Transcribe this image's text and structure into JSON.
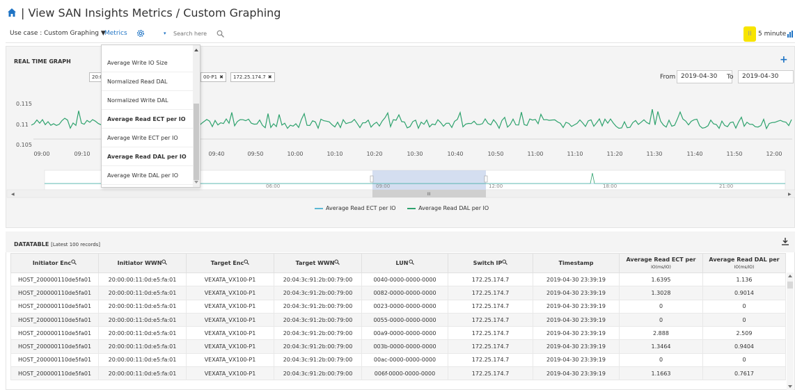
{
  "header": {
    "title": "| View SAN Insights Metrics / Custom Graphing"
  },
  "toolbar": {
    "use_case_label": "Use case : Custom Graphing ▼",
    "metrics_label": "Metrics",
    "metrics_caret": "▾",
    "search_placeholder": "Search here",
    "pause_label": "II",
    "interval_label": "5 minute",
    "accent_color": "#f7e400"
  },
  "realtime": {
    "title": "REAL TIME GRAPH",
    "tags": [
      {
        "label": "20:0"
      },
      {
        "label": "00-P1",
        "close": "✖"
      },
      {
        "label": "172.25.174.7",
        "close": "✖"
      }
    ],
    "from_label": "From",
    "from_value": "2019-04-30",
    "to_label": "To",
    "to_value": "2019-04-30"
  },
  "dropdown": {
    "items": [
      {
        "label": "Average Write IO Size",
        "bold": false
      },
      {
        "label": "Normalized Read DAL",
        "bold": false
      },
      {
        "label": "Normalized Write DAL",
        "bold": false
      },
      {
        "label": "Average Read ECT per IO",
        "bold": true
      },
      {
        "label": "Average Write ECT per IO",
        "bold": false
      },
      {
        "label": "Average Read DAL per IO",
        "bold": true
      },
      {
        "label": "Average Write DAL per IO",
        "bold": false
      }
    ]
  },
  "chart_data": {
    "type": "line",
    "x_ticks": [
      "09:00",
      "09:10",
      "09:40",
      "09:50",
      "10:00",
      "10:10",
      "10:20",
      "10:30",
      "10:40",
      "10:50",
      "11:00",
      "11:10",
      "11:20",
      "11:30",
      "11:40",
      "11:50",
      "12:00"
    ],
    "y_ticks": [
      "0.115",
      "0.11",
      "0.105"
    ],
    "ylim": [
      0.105,
      0.115
    ],
    "series": [
      {
        "name": "Average Read ECT per IO",
        "color": "#5bb8d4"
      },
      {
        "name": "Average Read DAL per IO",
        "color": "#2ea26d"
      }
    ],
    "navigator_ticks": [
      "06:00",
      "09:00",
      "12:00",
      "18:00",
      "21:00"
    ],
    "navigator_scroll_glyph": "III",
    "navigator_left_arrow": "◀",
    "navigator_right_arrow": "▶"
  },
  "datatable": {
    "title": "DATATABLE",
    "subtitle": "[Latest 100 records]",
    "columns": [
      {
        "label": "Initiator Enc",
        "sortable": true
      },
      {
        "label": "Initiator WWN",
        "sortable": true
      },
      {
        "label": "Target Enc",
        "sortable": true
      },
      {
        "label": "Target WWN",
        "sortable": true
      },
      {
        "label": "LUN",
        "sortable": true
      },
      {
        "label": "Switch IP",
        "sortable": true
      },
      {
        "label": "Timestamp",
        "sortable": false
      },
      {
        "label": "Average Read ECT per",
        "sub": "IO(ms/IO)"
      },
      {
        "label": "Average Read DAL per",
        "sub": "IO(ms/IO)"
      }
    ],
    "rows": [
      [
        "HOST_200000110de5fa01",
        "20:00:00:11:0d:e5:fa:01",
        "VEXATA_VX100-P1",
        "20:04:3c:91:2b:00:79:00",
        "0040-0000-0000-0000",
        "172.25.174.7",
        "2019-04-30 23:39:19",
        "1.6395",
        "1.136"
      ],
      [
        "HOST_200000110de5fa01",
        "20:00:00:11:0d:e5:fa:01",
        "VEXATA_VX100-P1",
        "20:04:3c:91:2b:00:79:00",
        "0082-0000-0000-0000",
        "172.25.174.7",
        "2019-04-30 23:39:19",
        "1.3028",
        "0.9014"
      ],
      [
        "HOST_200000110de5fa01",
        "20:00:00:11:0d:e5:fa:01",
        "VEXATA_VX100-P1",
        "20:04:3c:91:2b:00:79:00",
        "0023-0000-0000-0000",
        "172.25.174.7",
        "2019-04-30 23:39:19",
        "0",
        "0"
      ],
      [
        "HOST_200000110de5fa01",
        "20:00:00:11:0d:e5:fa:01",
        "VEXATA_VX100-P1",
        "20:04:3c:91:2b:00:79:00",
        "0055-0000-0000-0000",
        "172.25.174.7",
        "2019-04-30 23:39:19",
        "0",
        "0"
      ],
      [
        "HOST_200000110de5fa01",
        "20:00:00:11:0d:e5:fa:01",
        "VEXATA_VX100-P1",
        "20:04:3c:91:2b:00:79:00",
        "00a9-0000-0000-0000",
        "172.25.174.7",
        "2019-04-30 23:39:19",
        "2.888",
        "2.509"
      ],
      [
        "HOST_200000110de5fa01",
        "20:00:00:11:0d:e5:fa:01",
        "VEXATA_VX100-P1",
        "20:04:3c:91:2b:00:79:00",
        "003b-0000-0000-0000",
        "172.25.174.7",
        "2019-04-30 23:39:19",
        "1.3464",
        "0.9404"
      ],
      [
        "HOST_200000110de5fa01",
        "20:00:00:11:0d:e5:fa:01",
        "VEXATA_VX100-P1",
        "20:04:3c:91:2b:00:79:00",
        "00ac-0000-0000-0000",
        "172.25.174.7",
        "2019-04-30 23:39:19",
        "0",
        "0"
      ],
      [
        "HOST_200000110de5fa01",
        "20:00:00:11:0d:e5:fa:01",
        "VEXATA_VX100-P1",
        "20:04:3c:91:2b:00:79:00",
        "006f-0000-0000-0000",
        "172.25.174.7",
        "2019-04-30 23:39:19",
        "1.1663",
        "0.7617"
      ]
    ]
  }
}
